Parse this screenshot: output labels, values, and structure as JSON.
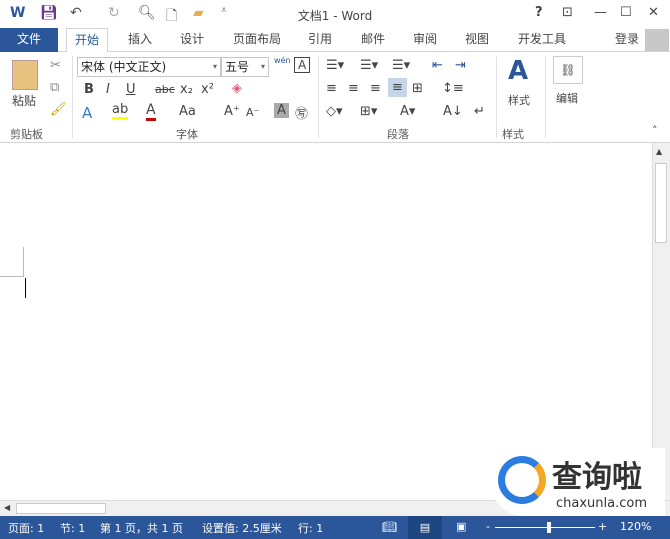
{
  "window": {
    "title": "文档1 - Word",
    "help": "?",
    "restore_ribbon": "⊡",
    "minimize": "—",
    "maximize": "☐",
    "close": "✕"
  },
  "tabs": [
    {
      "label": "文件"
    },
    {
      "label": "开始"
    },
    {
      "label": "插入"
    },
    {
      "label": "设计"
    },
    {
      "label": "页面布局"
    },
    {
      "label": "引用"
    },
    {
      "label": "邮件"
    },
    {
      "label": "审阅"
    },
    {
      "label": "视图"
    },
    {
      "label": "开发工具"
    }
  ],
  "account": {
    "login": "登录"
  },
  "ribbon": {
    "clipboard": {
      "paste": "粘贴",
      "group": "剪贴板"
    },
    "font": {
      "font_name": "宋体 (中文正文)",
      "font_size": "五号",
      "phonetic": "wén",
      "group": "字体",
      "bold": "B",
      "italic": "I",
      "underline": "U",
      "strike": "abc",
      "sub": "x₂",
      "sup": "x²",
      "case": "Aa"
    },
    "paragraph": {
      "group": "段落"
    },
    "styles": {
      "label": "样式",
      "group": "样式"
    },
    "editing": {
      "label": "编辑"
    }
  },
  "status": {
    "page": "页面: 1",
    "section": "节: 1",
    "page_of": "第 1 页，共 1 页",
    "position": "设置值: 2.5厘米",
    "line": "行: 1",
    "zoom": "120%",
    "zoom_percent": 120
  },
  "watermark": {
    "text": "查询啦",
    "domain": "chaxunla.com"
  },
  "colors": {
    "accent": "#2b579a"
  }
}
